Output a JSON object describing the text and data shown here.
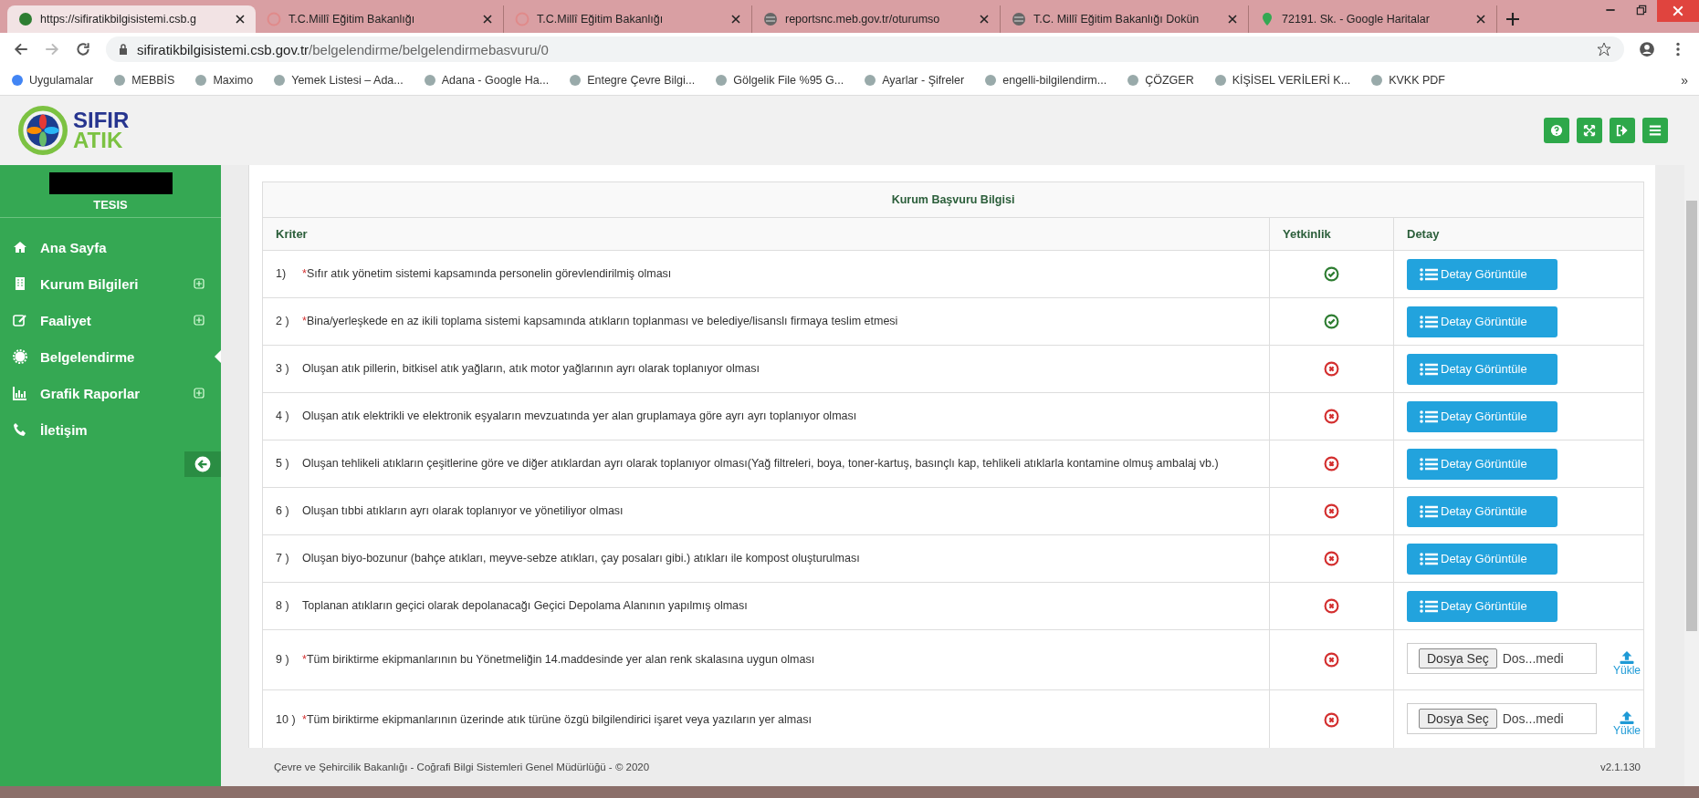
{
  "browser": {
    "tabs": [
      {
        "title": "https://sifiratikbilgisistemi.csb.g",
        "selected": true,
        "kind": "site"
      },
      {
        "title": "T.C.Millî Eğitim Bakanlığı",
        "selected": false,
        "kind": "seal"
      },
      {
        "title": "T.C.Millî Eğitim Bakanlığı",
        "selected": false,
        "kind": "seal"
      },
      {
        "title": "reportsnc.meb.gov.tr/oturumso",
        "selected": false,
        "kind": "globe"
      },
      {
        "title": "T.C. Millî Eğitim Bakanlığı Dokün",
        "selected": false,
        "kind": "globe"
      },
      {
        "title": "72191. Sk. - Google Haritalar",
        "selected": false,
        "kind": "pin"
      }
    ],
    "url_host": "sifiratikbilgisistemi.csb.gov.tr",
    "url_path": "/belgelendirme/belgelendirmebasvuru/0",
    "bookmarks": [
      "Uygulamalar",
      "MEBBİS",
      "Maximo",
      "Yemek Listesi – Ada...",
      "Adana - Google Ha...",
      "Entegre Çevre Bilgi...",
      "Gölgelik File %95 G...",
      "Ayarlar - Şifreler",
      "engelli-bilgilendirm...",
      "ÇÖZGER",
      "KİŞİSEL VERİLERİ K...",
      "KVKK PDF"
    ],
    "more": "»"
  },
  "logo": {
    "line1": "SIFIR",
    "line2": "ATIK"
  },
  "sidebar": {
    "role": "TESIS",
    "items": [
      {
        "label": "Ana Sayfa",
        "kind": "home",
        "expandable": false,
        "selected": false
      },
      {
        "label": "Kurum Bilgileri",
        "kind": "building",
        "expandable": true,
        "selected": false
      },
      {
        "label": "Faaliyet",
        "kind": "edit",
        "expandable": true,
        "selected": false
      },
      {
        "label": "Belgelendirme",
        "kind": "badge",
        "expandable": false,
        "selected": true
      },
      {
        "label": "Grafik Raporlar",
        "kind": "chart",
        "expandable": true,
        "selected": false
      },
      {
        "label": "İletişim",
        "kind": "phone",
        "expandable": false,
        "selected": false
      }
    ]
  },
  "table": {
    "title": "Kurum Başvuru Bilgisi",
    "columns": [
      "Kriter",
      "Yetkinlik",
      "Detay"
    ],
    "rows": [
      {
        "number": "1)",
        "mark": "*",
        "text": "Sıfır atık yönetim sistemi kapsamında personelin görevlendirilmiş olması",
        "met": true,
        "kind": "detail",
        "button": "Detay Görüntüle"
      },
      {
        "number": "2 )",
        "mark": "*",
        "text": "Bina/yerleşkede en az ikili toplama sistemi kapsamında atıkların toplanması ve belediye/lisanslı firmaya teslim etmesi",
        "met": true,
        "kind": "detail",
        "button": "Detay Görüntüle"
      },
      {
        "number": "3 )",
        "text": "Oluşan atık pillerin, bitkisel atık yağların, atık motor yağlarının ayrı olarak toplanıyor olması",
        "met": false,
        "kind": "detail",
        "button": "Detay Görüntüle"
      },
      {
        "number": "4 )",
        "text": "Oluşan atık elektrikli ve elektronik eşyaların mevzuatında yer alan gruplamaya göre ayrı ayrı toplanıyor olması",
        "met": false,
        "kind": "detail",
        "button": "Detay Görüntüle"
      },
      {
        "number": "5 )",
        "text": "Oluşan tehlikeli atıkların çeşitlerine göre ve diğer atıklardan ayrı olarak toplanıyor olması(Yağ filtreleri, boya, toner-kartuş, basınçlı kap, tehlikeli atıklarla kontamine olmuş ambalaj vb.)",
        "met": false,
        "kind": "detail",
        "button": "Detay Görüntüle"
      },
      {
        "number": "6 )",
        "text": "Oluşan tıbbi atıkların ayrı olarak toplanıyor ve yönetiliyor olması",
        "met": false,
        "kind": "detail",
        "button": "Detay Görüntüle"
      },
      {
        "number": "7 )",
        "text": "Oluşan biyo-bozunur (bahçe atıkları, meyve-sebze atıkları, çay posaları gibi.) atıkları ile kompost oluşturulması",
        "met": false,
        "kind": "detail",
        "button": "Detay Görüntüle"
      },
      {
        "number": "8 )",
        "text": "Toplanan atıkların geçici olarak depolanacağı Geçici Depolama Alanının yapılmış olması",
        "met": false,
        "kind": "detail",
        "button": "Detay Görüntüle"
      },
      {
        "number": "9 )",
        "mark": "*",
        "text": "Tüm biriktirme ekipmanlarının bu Yönetmeliğin 14.maddesinde yer alan renk skalasına uygun olması",
        "met": false,
        "kind": "upload",
        "button": "Dosya Seç",
        "file": "Dos...medi",
        "upload": "Yükle"
      },
      {
        "number": "10 )",
        "mark": "*",
        "text": "Tüm biriktirme ekipmanlarının üzerinde atık türüne özgü bilgilendirici işaret veya yazıların yer alması",
        "met": false,
        "kind": "upload",
        "button": "Dosya Seç",
        "file": "Dos...medi",
        "upload": "Yükle"
      }
    ]
  },
  "footer": {
    "text": "Çevre ve Şehircilik Bakanlığı - Coğrafi Bilgi Sistemleri Genel Müdürlüğü - © 2020",
    "version": "v2.1.130"
  }
}
